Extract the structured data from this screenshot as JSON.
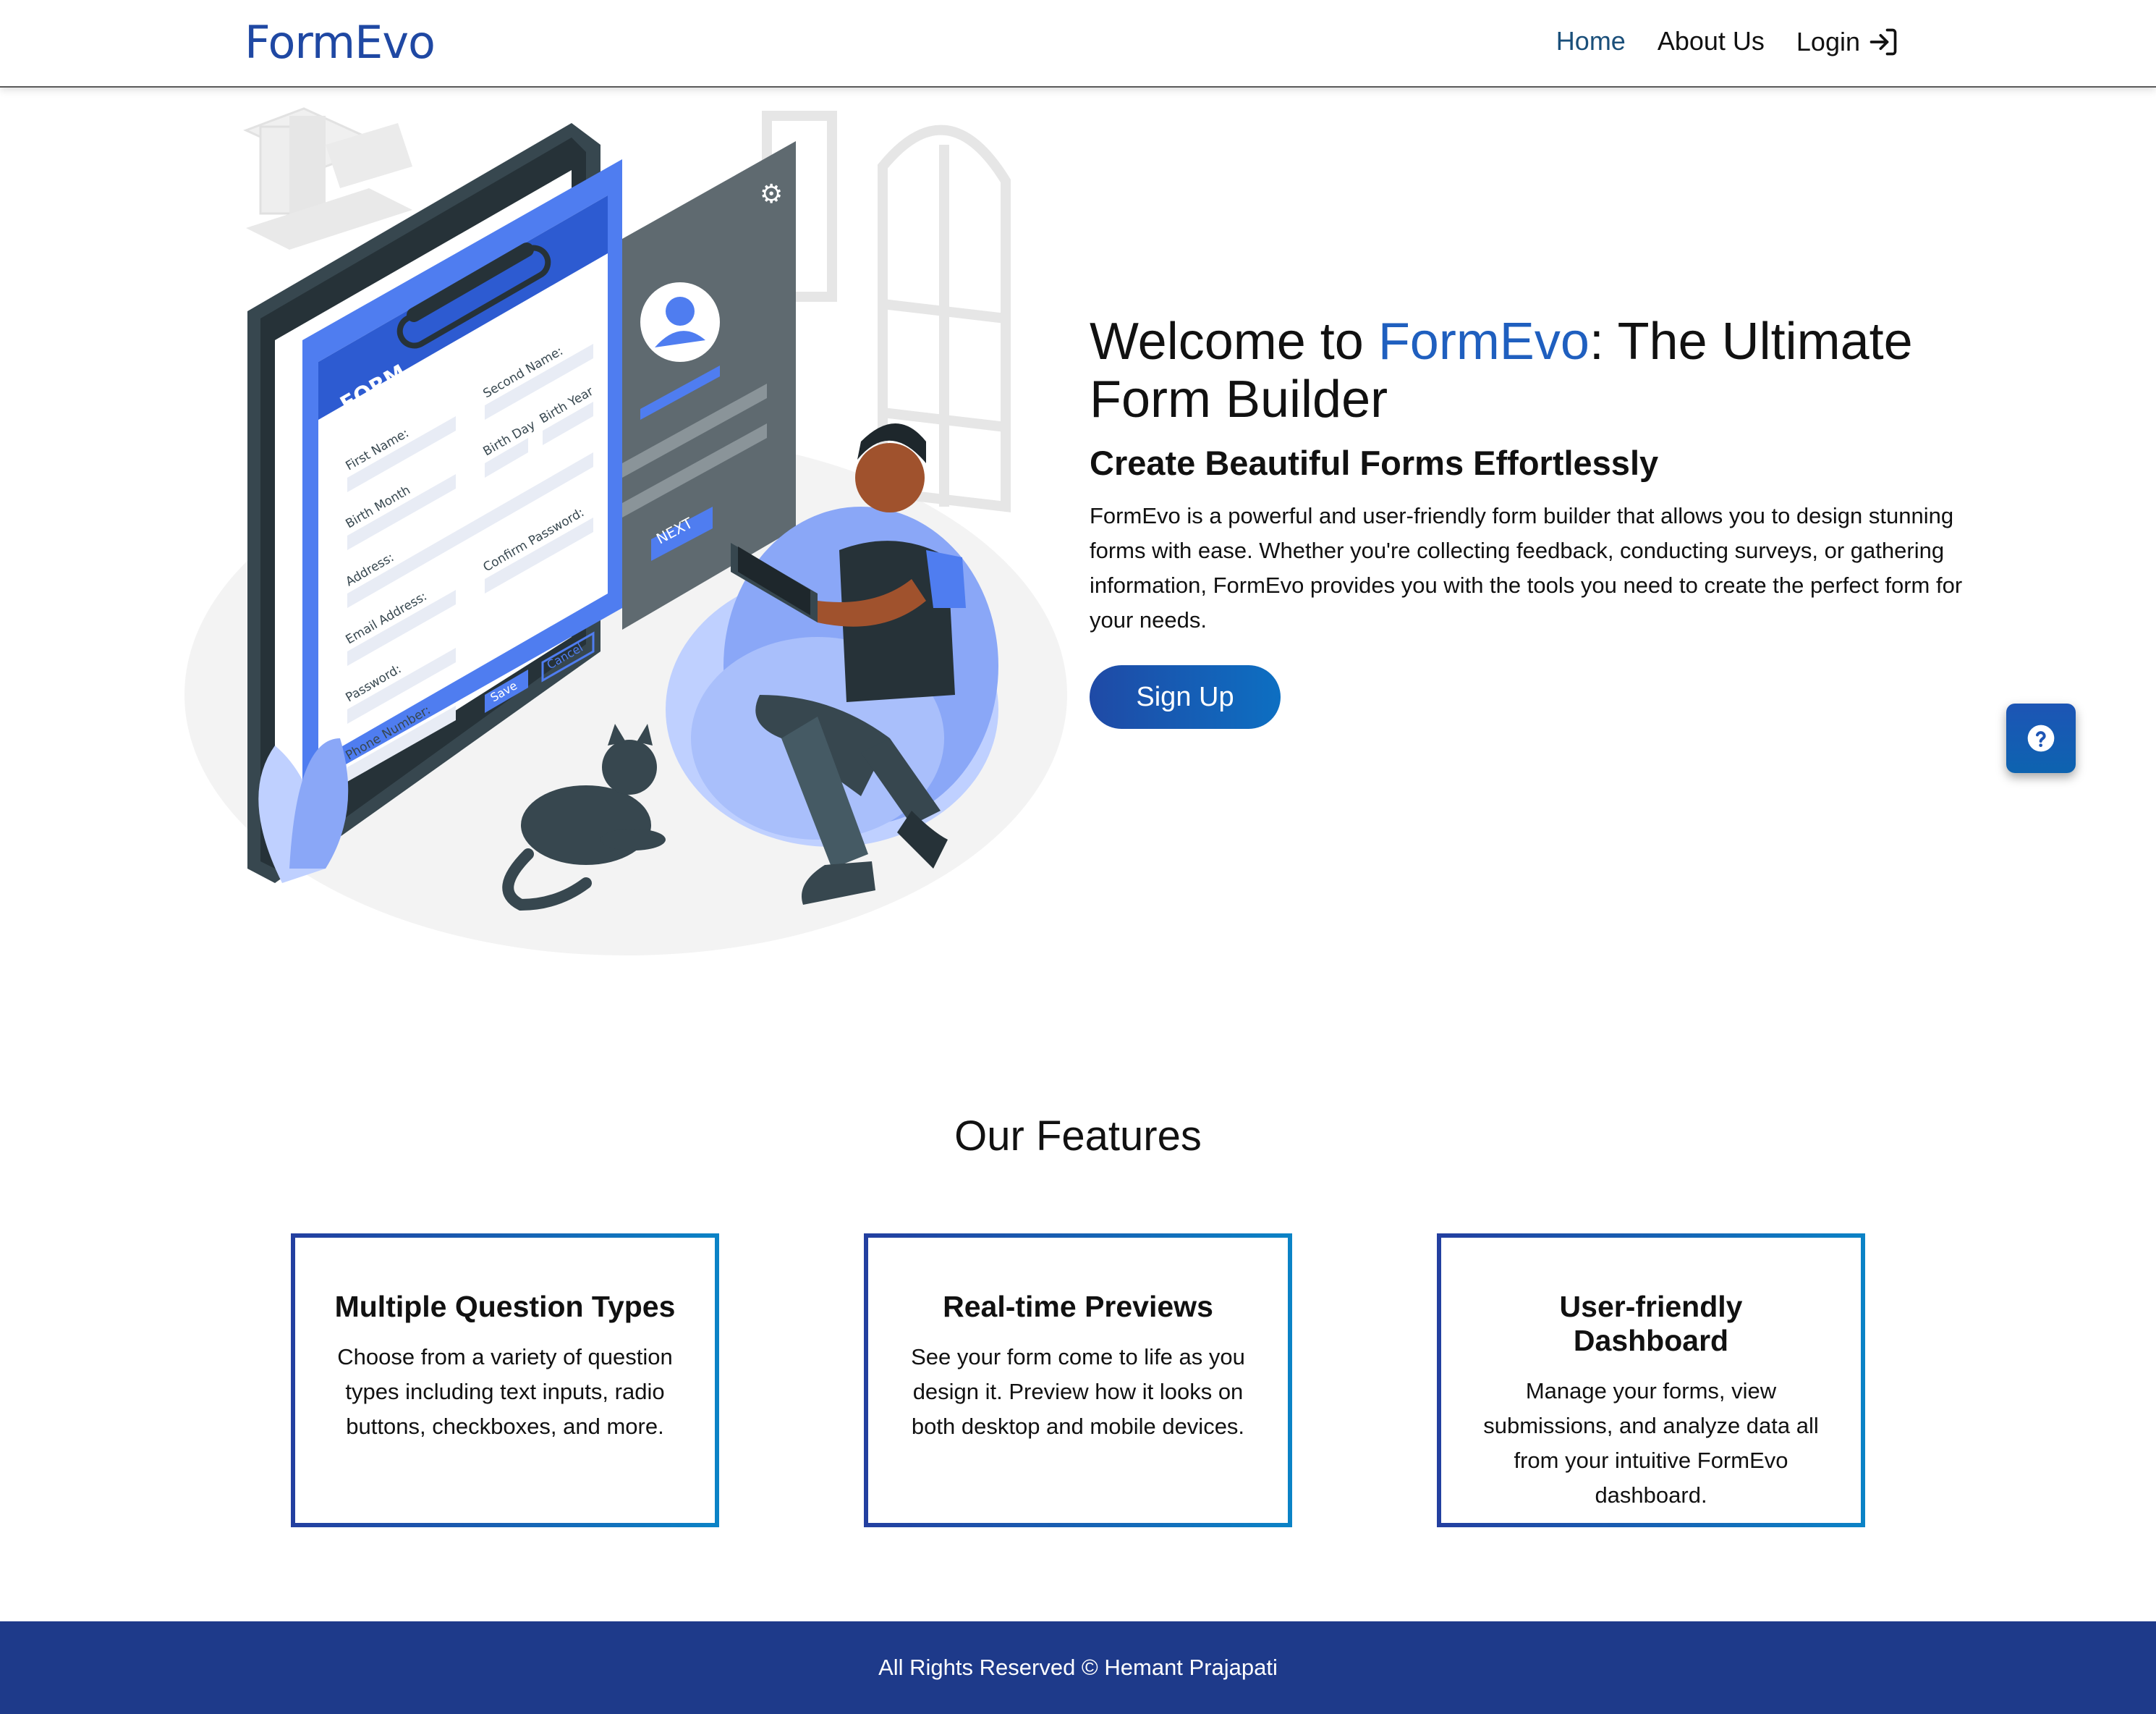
{
  "nav": {
    "brand": "FormEvo",
    "home": "Home",
    "about": "About Us",
    "login": "Login"
  },
  "hero": {
    "title_prefix": "Welcome to ",
    "title_accent": "FormEvo",
    "title_suffix": ": The Ultimate Form Builder",
    "subtitle": "Create Beautiful Forms Effortlessly",
    "description": "FormEvo is a powerful and user-friendly form builder that allows you to design stunning forms with ease. Whether you're collecting feedback, conducting surveys, or gathering information, FormEvo provides you with the tools you need to create the perfect form for your needs.",
    "cta": "Sign Up"
  },
  "illustration": {
    "form_heading": "FORM",
    "fields": [
      "First Name:",
      "Second Name:",
      "Birth Month",
      "Birth Day",
      "Birth Year",
      "Address:",
      "Email Address:",
      "Confirm Password:",
      "Password:",
      "Phone Number:"
    ],
    "save": "Save",
    "cancel": "Cancel",
    "next": "NEXT"
  },
  "features": {
    "title": "Our Features",
    "items": [
      {
        "title": "Multiple Question Types",
        "desc": "Choose from a variety of question types including text inputs, radio buttons, checkboxes, and more."
      },
      {
        "title": "Real-time Previews",
        "desc": "See your form come to life as you design it. Preview how it looks on both desktop and mobile devices."
      },
      {
        "title": "User-friendly Dashboard",
        "desc": "Manage your forms, view submissions, and analyze data all from your intuitive FormEvo dashboard."
      }
    ]
  },
  "help": {
    "icon": "question-circle-icon"
  },
  "footer": {
    "text": "All Rights Reserved © Hemant Prajapati"
  },
  "colors": {
    "brand": "#1f48a3",
    "accent": "#1f5fbf",
    "footer": "#1e3a8a",
    "illustration_blue": "#4f7df0"
  }
}
